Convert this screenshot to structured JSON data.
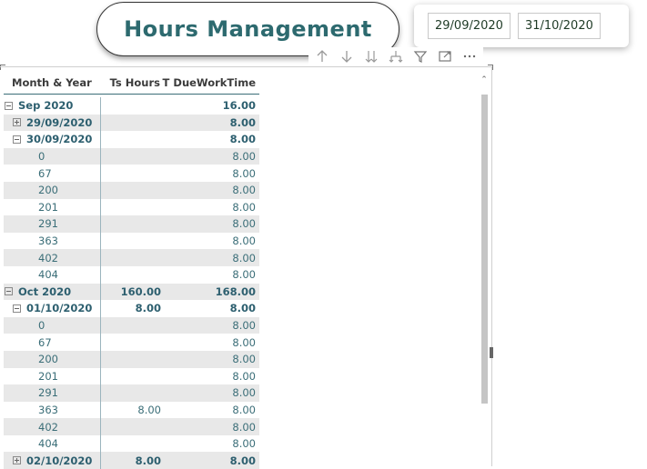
{
  "title": "Hours Management",
  "date_filter": {
    "start": "29/09/2020",
    "end": "31/10/2020"
  },
  "toolbar": [
    {
      "name": "drill-up-icon",
      "glyph": "↑"
    },
    {
      "name": "drill-down-icon",
      "glyph": "↓"
    },
    {
      "name": "expand-next-level-icon",
      "glyph": "⇊"
    },
    {
      "name": "expand-all-icon",
      "glyph": "⅄"
    },
    {
      "name": "filter-icon",
      "glyph": "filter"
    },
    {
      "name": "focus-mode-icon",
      "glyph": "focus"
    },
    {
      "name": "more-options-icon",
      "glyph": "⋯"
    }
  ],
  "matrix": {
    "columns": [
      "Month & Year",
      "Ts Hours",
      "T DueWorkTime"
    ],
    "rows": [
      {
        "level": 0,
        "label": "Sep 2020",
        "ts": "",
        "due": "16.00",
        "toggle": "minus",
        "bold": true
      },
      {
        "level": 1,
        "label": "29/09/2020",
        "ts": "",
        "due": "8.00",
        "toggle": "plus",
        "bold": true
      },
      {
        "level": 1,
        "label": "30/09/2020",
        "ts": "",
        "due": "8.00",
        "toggle": "minus",
        "bold": true
      },
      {
        "level": 2,
        "label": "0",
        "ts": "",
        "due": "8.00"
      },
      {
        "level": 2,
        "label": "67",
        "ts": "",
        "due": "8.00"
      },
      {
        "level": 2,
        "label": "200",
        "ts": "",
        "due": "8.00"
      },
      {
        "level": 2,
        "label": "201",
        "ts": "",
        "due": "8.00"
      },
      {
        "level": 2,
        "label": "291",
        "ts": "",
        "due": "8.00"
      },
      {
        "level": 2,
        "label": "363",
        "ts": "",
        "due": "8.00"
      },
      {
        "level": 2,
        "label": "402",
        "ts": "",
        "due": "8.00"
      },
      {
        "level": 2,
        "label": "404",
        "ts": "",
        "due": "8.00"
      },
      {
        "level": 0,
        "label": "Oct 2020",
        "ts": "160.00",
        "due": "168.00",
        "toggle": "minus",
        "bold": true
      },
      {
        "level": 1,
        "label": "01/10/2020",
        "ts": "8.00",
        "due": "8.00",
        "toggle": "minus",
        "bold": true
      },
      {
        "level": 2,
        "label": "0",
        "ts": "",
        "due": "8.00"
      },
      {
        "level": 2,
        "label": "67",
        "ts": "",
        "due": "8.00"
      },
      {
        "level": 2,
        "label": "200",
        "ts": "",
        "due": "8.00"
      },
      {
        "level": 2,
        "label": "201",
        "ts": "",
        "due": "8.00"
      },
      {
        "level": 2,
        "label": "291",
        "ts": "",
        "due": "8.00"
      },
      {
        "level": 2,
        "label": "363",
        "ts": "8.00",
        "due": "8.00"
      },
      {
        "level": 2,
        "label": "402",
        "ts": "",
        "due": "8.00"
      },
      {
        "level": 2,
        "label": "404",
        "ts": "",
        "due": "8.00"
      },
      {
        "level": 1,
        "label": "02/10/2020",
        "ts": "8.00",
        "due": "8.00",
        "toggle": "plus",
        "bold": true
      }
    ]
  },
  "colors": {
    "accent": "#2d6a6f",
    "row_alt": "#e8e8e8",
    "text": "#3b6e78"
  }
}
